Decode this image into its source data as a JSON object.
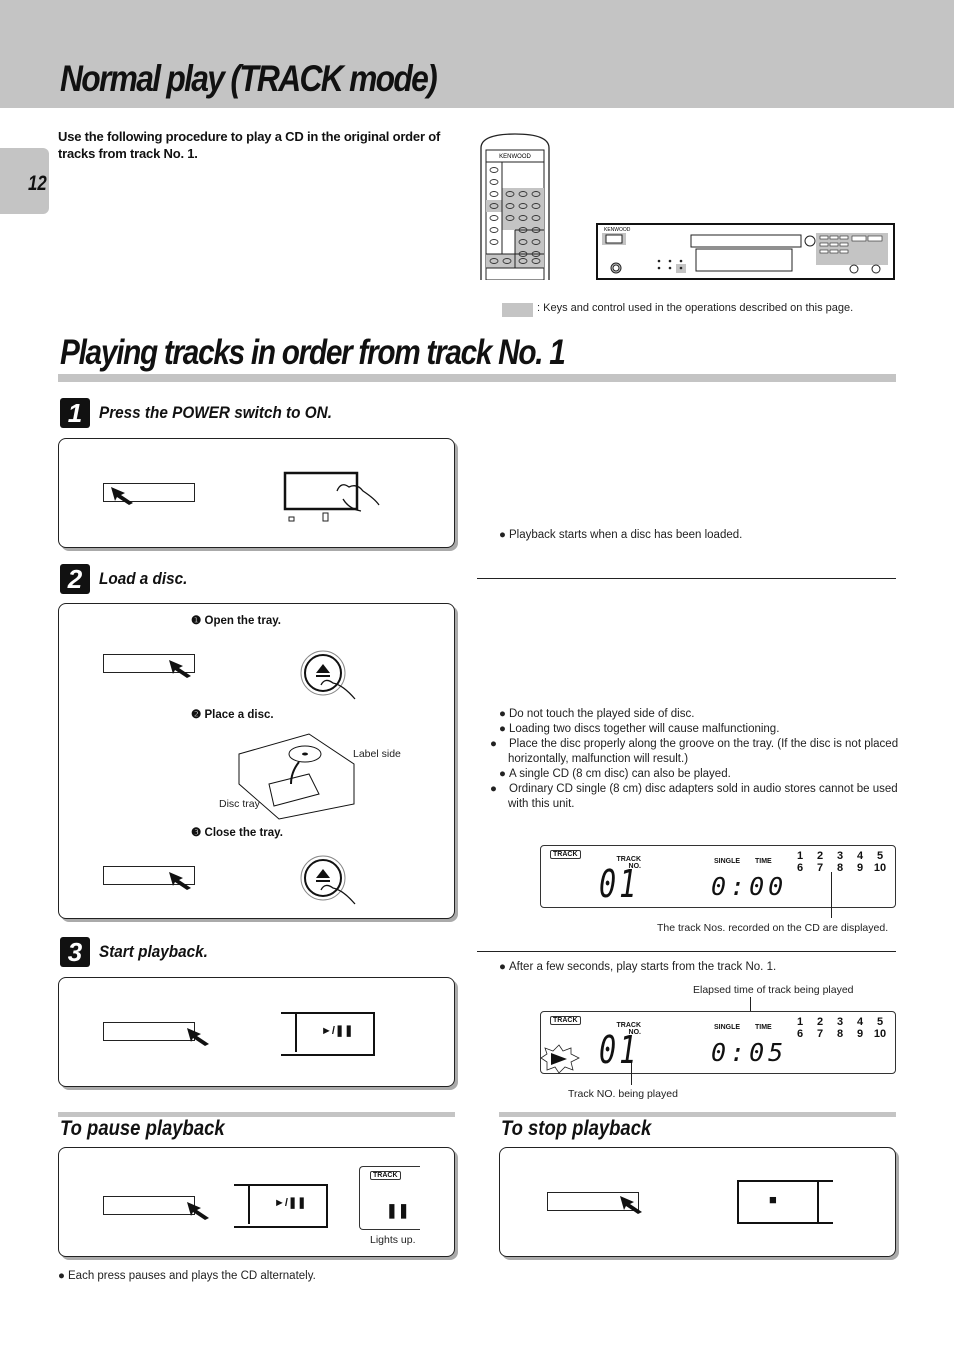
{
  "header": {
    "title": "Normal play  (TRACK mode)"
  },
  "page_number": "12",
  "intro": "Use the following procedure to play a CD in the original order of tracks from track No. 1.",
  "illustrations": {
    "remote_brand": "KENWOOD",
    "unit_brand": "KENWOOD"
  },
  "legend": {
    "text": ": Keys and control used in the operations described on this page.",
    "highlight_color": "#c4c4c4"
  },
  "section": {
    "title": "Playing tracks in order from track No. 1"
  },
  "steps": [
    {
      "number": "1",
      "title": "Press the POWER switch to ON.",
      "notes": [
        "Playback starts when a disc has been loaded."
      ]
    },
    {
      "number": "2",
      "title": "Load a disc.",
      "substeps": [
        "Open the tray.",
        "Place a disc.",
        "Close the tray."
      ],
      "substep_markers": [
        "❶",
        "❷",
        "❸"
      ],
      "labels": {
        "label_side": "Label side",
        "disc_tray": "Disc tray"
      },
      "notes": [
        "Do not touch the played side of disc.",
        "Loading two discs together will cause malfunctioning.",
        "Place the disc properly along the groove on the tray. (If the disc is not placed horizontally, malfunction will result.)",
        "A single CD (8 cm disc) can also be played.",
        "Ordinary CD single (8 cm) disc adapters sold in audio stores cannot be used with this unit."
      ],
      "display": {
        "mode": "TRACK",
        "track_label": "TRACK NO.",
        "single_label": "SINGLE",
        "time_label": "TIME",
        "track_no": "01",
        "time": "0:00",
        "track_list_row1": [
          "1",
          "2",
          "3",
          "4",
          "5"
        ],
        "track_list_row2": [
          "6",
          "7",
          "8",
          "9",
          "10"
        ],
        "caption": "The track Nos. recorded on the CD are displayed."
      }
    },
    {
      "number": "3",
      "title": "Start playback.",
      "button_label": "►/❚❚",
      "notes": [
        "After a few seconds, play starts from the track No. 1."
      ],
      "display": {
        "mode": "TRACK",
        "track_label": "TRACK NO.",
        "single_label": "SINGLE",
        "time_label": "TIME",
        "track_no": "01",
        "time": "0:05",
        "play_indicator": "►",
        "track_list_row1": [
          "1",
          "2",
          "3",
          "4",
          "5"
        ],
        "track_list_row2": [
          "6",
          "7",
          "8",
          "9",
          "10"
        ],
        "caption_top": "Elapsed time of track being played",
        "caption_bottom": "Track NO. being played"
      }
    }
  ],
  "pause": {
    "title": "To pause playback",
    "button_label": "►/❚❚",
    "display_mode": "TRACK",
    "pause_indicator": "❚❚",
    "lights_up": "Lights up.",
    "note": "Each press pauses and plays the CD alternately."
  },
  "stop": {
    "title": "To stop playback",
    "button_label": "■"
  }
}
